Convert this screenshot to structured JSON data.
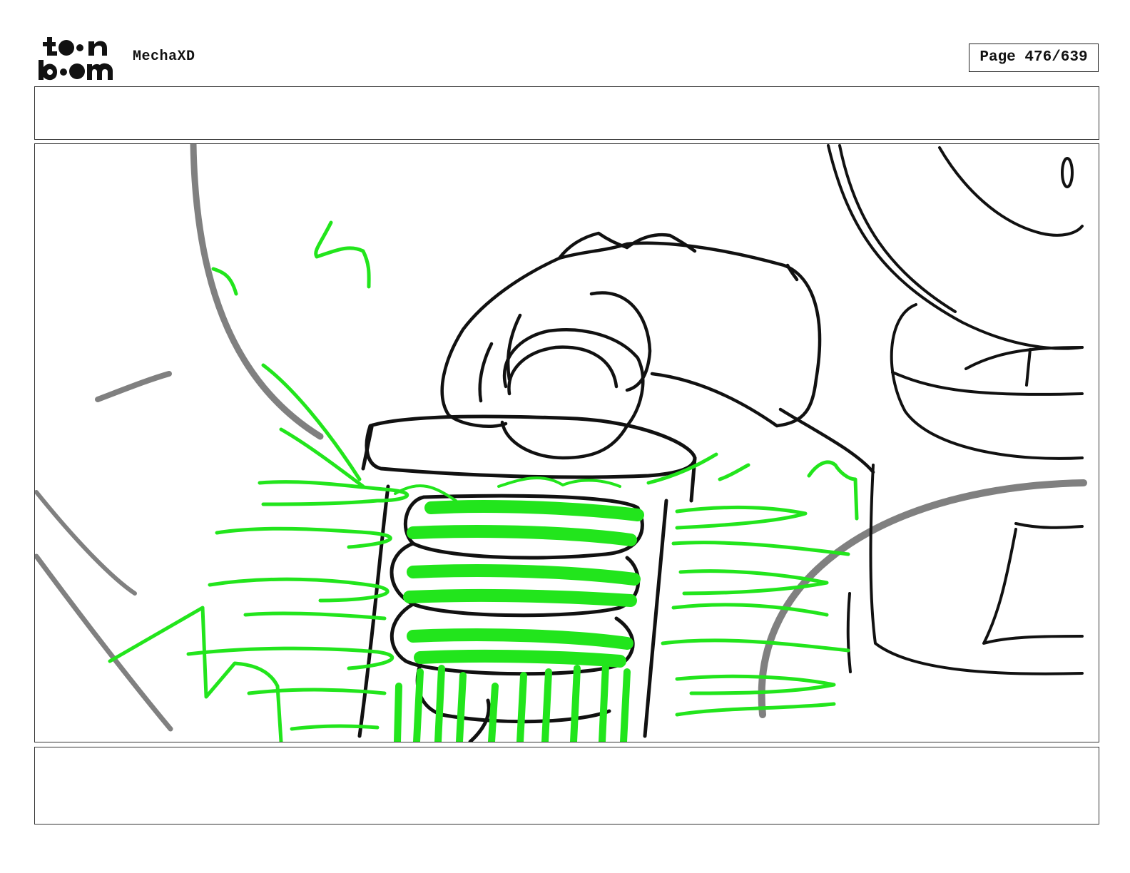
{
  "header": {
    "logo": {
      "icon": "toon-boom-logo",
      "line1": "toon",
      "line2": "boom"
    },
    "project_title": "MechaXD",
    "page_number": "Page 476/639"
  },
  "panel": {
    "icon": "storyboard-sketch",
    "palette": {
      "ink": "#111111",
      "shadow": "#808080",
      "energy": "#22e51c"
    }
  },
  "action_notes": "",
  "dialogue_notes": ""
}
